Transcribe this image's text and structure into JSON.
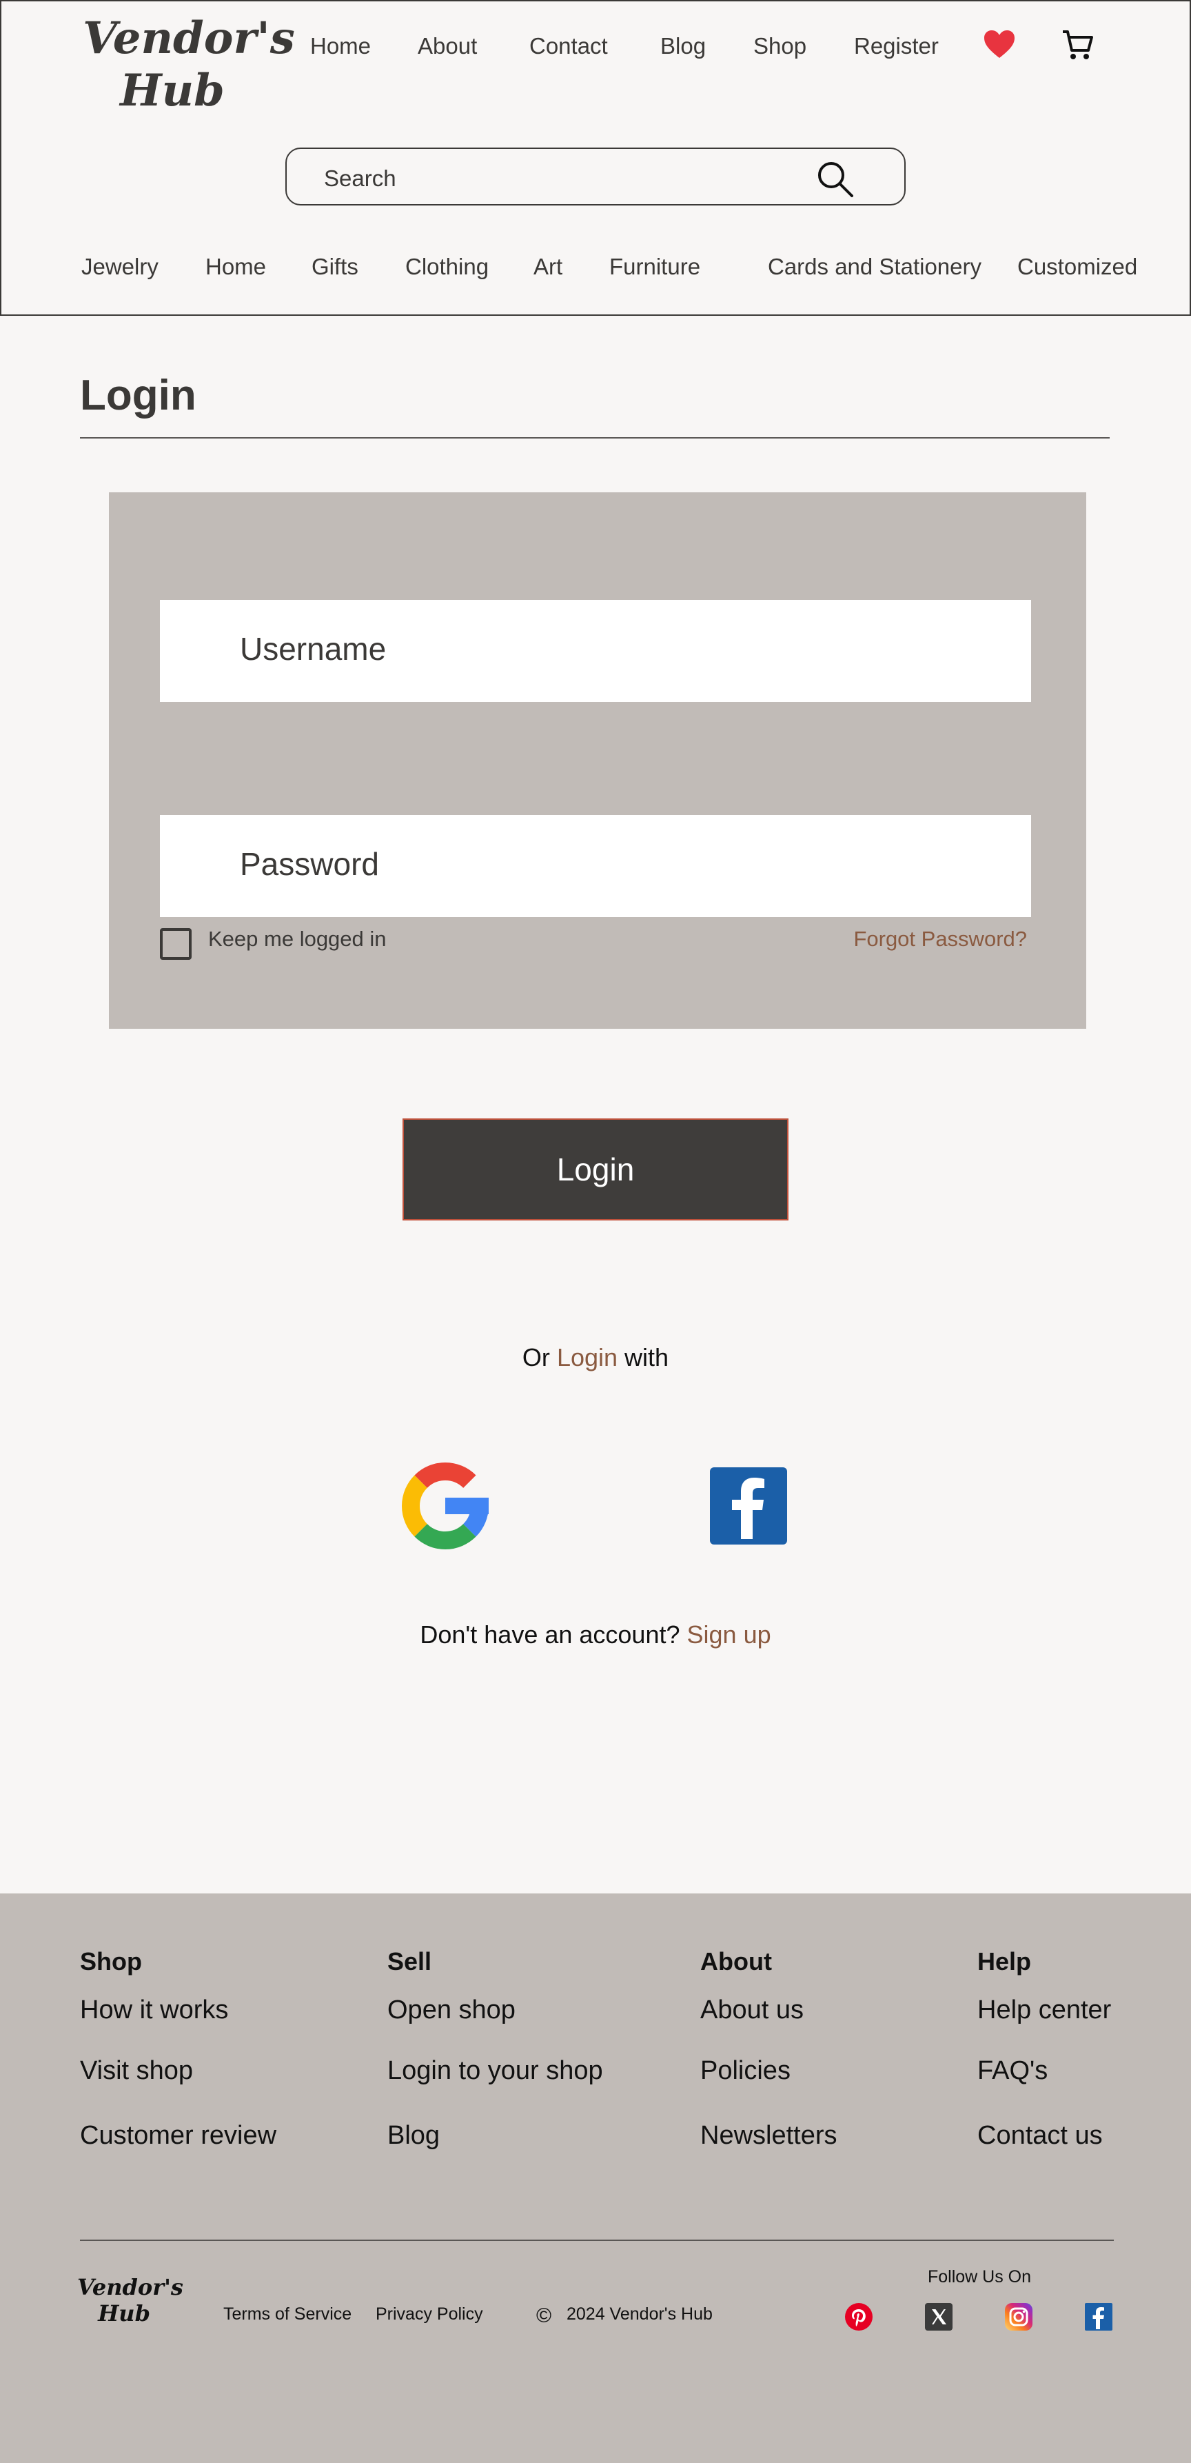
{
  "header": {
    "logo": "Vendor's Hub",
    "nav": [
      "Home",
      "About",
      "Contact",
      "Blog",
      "Shop",
      "Register"
    ],
    "icons": {
      "wishlist": "heart-icon",
      "cart": "cart-icon"
    },
    "search_placeholder": "Search",
    "categories": [
      "Jewelry",
      "Home",
      "Gifts",
      "Clothing",
      "Art",
      "Furniture",
      "Cards and Stationery",
      "Customized"
    ]
  },
  "main": {
    "title": "Login",
    "username_placeholder": "Username",
    "password_placeholder": "Password",
    "keep_logged_in": "Keep me logged in",
    "forgot_password": "Forgot Password?",
    "login_button": "Login",
    "or_prefix": "Or",
    "or_link": "Login",
    "or_suffix": "with",
    "social_login": [
      "google-icon",
      "facebook-icon"
    ],
    "no_account": "Don't have an account?",
    "signup": "Sign up"
  },
  "footer": {
    "columns": [
      {
        "heading": "Shop",
        "links": [
          "How it works",
          "Visit shop",
          "Customer review"
        ]
      },
      {
        "heading": "Sell",
        "links": [
          "Open shop",
          "Login to your shop",
          "Blog"
        ]
      },
      {
        "heading": "About",
        "links": [
          "About us",
          "Policies",
          "Newsletters"
        ]
      },
      {
        "heading": "Help",
        "links": [
          "Help center",
          "FAQ's",
          "Contact us"
        ]
      }
    ],
    "logo": "Vendor's Hub",
    "terms": "Terms of Service",
    "privacy": "Privacy Policy",
    "copyright": "2024 Vendor's Hub",
    "follow": "Follow Us On",
    "social": [
      "pinterest-icon",
      "x-icon",
      "instagram-icon",
      "facebook-icon"
    ]
  },
  "colors": {
    "text": "#3b3937",
    "background": "#f8f6f5",
    "panel": "#c1bbb7",
    "accent": "#8a5a40",
    "button": "#3f3d3b",
    "heart": "#e8343f"
  }
}
